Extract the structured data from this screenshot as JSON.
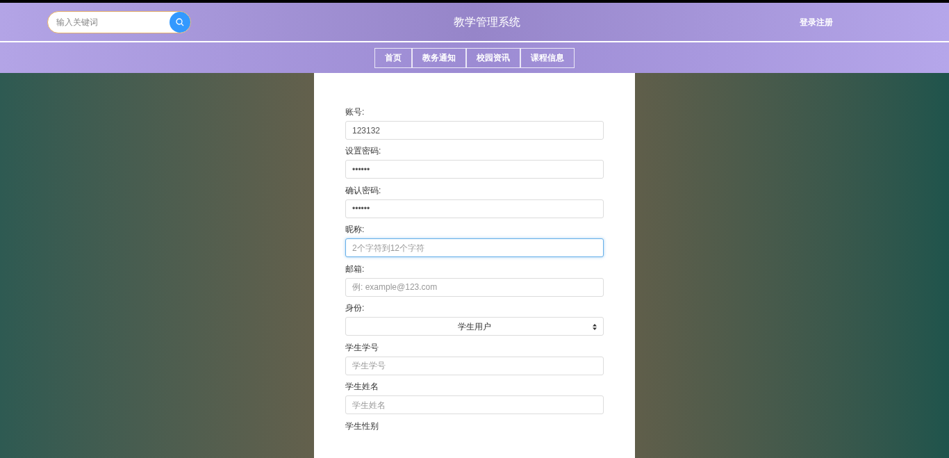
{
  "header": {
    "search": {
      "placeholder": "输入关键词"
    },
    "title": "教学管理系统",
    "login": "登录注册"
  },
  "nav": [
    {
      "label": "首页"
    },
    {
      "label": "教务通知"
    },
    {
      "label": "校园资讯"
    },
    {
      "label": "课程信息"
    }
  ],
  "form": {
    "fields": [
      {
        "kind": "input",
        "label": "账号:",
        "value": "123132",
        "focused": false
      },
      {
        "kind": "input",
        "label": "设置密码:",
        "value": "••••••",
        "focused": false
      },
      {
        "kind": "input",
        "label": "确认密码:",
        "value": "••••••",
        "focused": false
      },
      {
        "kind": "input",
        "label": "昵称:",
        "placeholder": "2个字符到12个字符",
        "focused": true
      },
      {
        "kind": "input",
        "label": "邮箱:",
        "placeholder": "例: example@123.com",
        "focused": false
      },
      {
        "kind": "select",
        "label": "身份:",
        "value": "学生用户",
        "focused": false
      },
      {
        "kind": "input",
        "label": "学生学号",
        "placeholder": "学生学号",
        "focused": false
      },
      {
        "kind": "input",
        "label": "学生姓名",
        "placeholder": "学生姓名",
        "focused": false
      },
      {
        "kind": "label",
        "label": "学生性别"
      }
    ]
  }
}
